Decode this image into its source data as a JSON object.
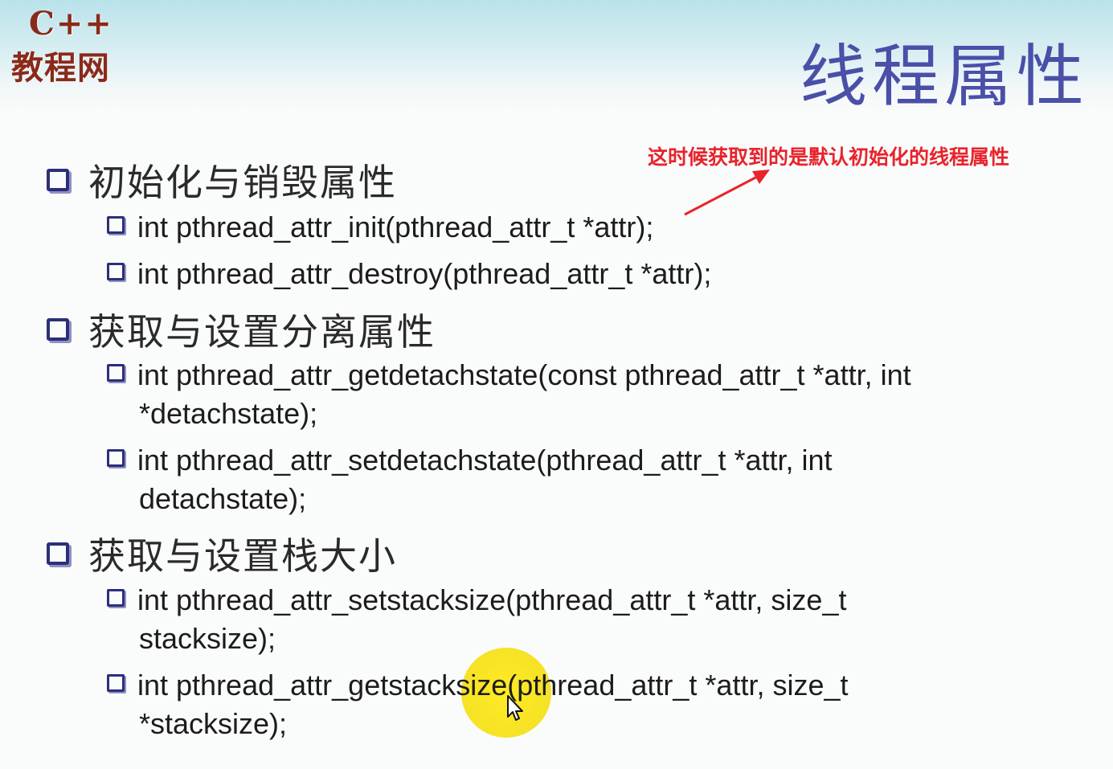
{
  "logo": {
    "top": "C++",
    "bottom": "教程网"
  },
  "title": "线程属性",
  "annotation": "这时候获取到的是默认初始化的线程属性",
  "sections": [
    {
      "heading": "初始化与销毁属性",
      "items": [
        {
          "line1": "int pthread_attr_init(pthread_attr_t *attr);"
        },
        {
          "line1": "int pthread_attr_destroy(pthread_attr_t *attr);"
        }
      ]
    },
    {
      "heading": "获取与设置分离属性",
      "items": [
        {
          "line1": "int pthread_attr_getdetachstate(const pthread_attr_t *attr, int",
          "line2": "*detachstate);"
        },
        {
          "line1": "int pthread_attr_setdetachstate(pthread_attr_t *attr, int",
          "line2": "detachstate);"
        }
      ]
    },
    {
      "heading": "获取与设置栈大小",
      "items": [
        {
          "line1": "int pthread_attr_setstacksize(pthread_attr_t *attr, size_t",
          "line2": "stacksize);"
        },
        {
          "line1": "int pthread_attr_getstacksize(pthread_attr_t *attr, size_t",
          "line2": "*stacksize);"
        }
      ]
    }
  ],
  "colors": {
    "title": "#4a4fa8",
    "annotation": "#e8232b",
    "bullet": "#2b2f7a",
    "highlight": "#ffea1a"
  },
  "icons": {
    "bullet": "square-bullet-icon",
    "arrow": "red-arrow-icon",
    "cursor": "mouse-pointer-icon"
  }
}
